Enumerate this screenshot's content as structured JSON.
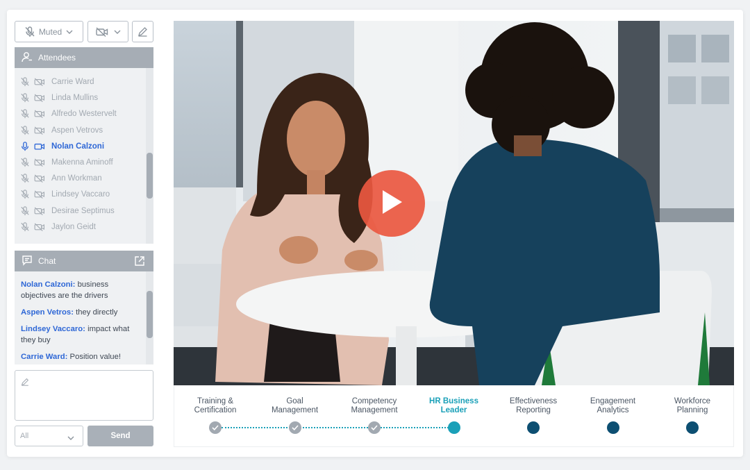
{
  "toolbar": {
    "mute_label": "Muted"
  },
  "attendees": {
    "title": "Attendees",
    "people": [
      {
        "name": "Carrie Ward",
        "active": false
      },
      {
        "name": "Linda Mullins",
        "active": false
      },
      {
        "name": "Alfredo Westervelt",
        "active": false
      },
      {
        "name": "Aspen Vetrovs",
        "active": false
      },
      {
        "name": "Nolan Calzoni",
        "active": true
      },
      {
        "name": "Makenna Aminoff",
        "active": false
      },
      {
        "name": "Ann Workman",
        "active": false
      },
      {
        "name": "Lindsey Vaccaro",
        "active": false
      },
      {
        "name": "Desirae Septimus",
        "active": false
      },
      {
        "name": "Jaylon Geidt",
        "active": false
      }
    ]
  },
  "chat": {
    "title": "Chat",
    "messages": [
      {
        "sender": "Nolan Calzoni:",
        "text": " business objectives are the drivers"
      },
      {
        "sender": "Aspen Vetros:",
        "text": " they directly"
      },
      {
        "sender": "Lindsey Vaccaro:",
        "text": " impact what they buy"
      },
      {
        "sender": "Carrie Ward:",
        "text": " Position value!"
      }
    ],
    "recipient_select": "All",
    "send_label": "Send"
  },
  "stepper": {
    "steps": [
      {
        "label": "Training &\nCertification",
        "status": "done"
      },
      {
        "label": "Goal\nManagement",
        "status": "done"
      },
      {
        "label": "Competency\nManagement",
        "status": "done"
      },
      {
        "label": "HR Business\nLeader",
        "status": "current"
      },
      {
        "label": "Effectiveness\nReporting",
        "status": "todo"
      },
      {
        "label": "Engagement\nAnalytics",
        "status": "todo"
      },
      {
        "label": "Workforce\nPlanning",
        "status": "todo"
      }
    ]
  },
  "colors": {
    "accent_blue": "#2e67d6",
    "teal_current": "#1aa0b8",
    "navy_todo": "#0d4f72",
    "play_button": "#ea5840"
  },
  "icons": {
    "mic_muted": "mic-off-icon",
    "cam_off": "video-off-icon",
    "edit": "pencil-icon",
    "attendees": "user-icon",
    "chat": "chat-bubble-icon",
    "popout": "external-link-icon",
    "play": "play-icon"
  }
}
